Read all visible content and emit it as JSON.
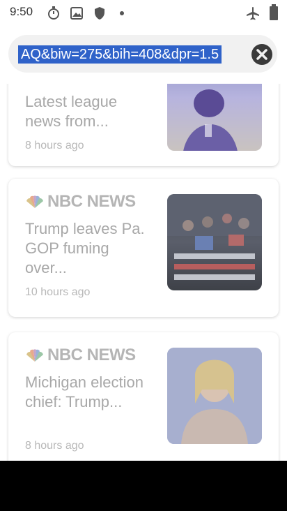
{
  "status_bar": {
    "time": "9:50"
  },
  "url_bar": {
    "value": "AQ&biw=275&bih=408&dpr=1.5"
  },
  "feed": {
    "cards": [
      {
        "headline": "Latest league news from...",
        "time": "8 hours ago"
      },
      {
        "source": "NBC NEWS",
        "headline": "Trump leaves Pa. GOP fuming over...",
        "time": "10 hours ago"
      },
      {
        "source": "NBC NEWS",
        "headline": "Michigan election chief: Trump...",
        "time": "8 hours ago"
      }
    ]
  },
  "colors": {
    "selection": "#2f62c9",
    "url_bg": "#f1f1f1",
    "faded_text": "#a8a8a8"
  }
}
